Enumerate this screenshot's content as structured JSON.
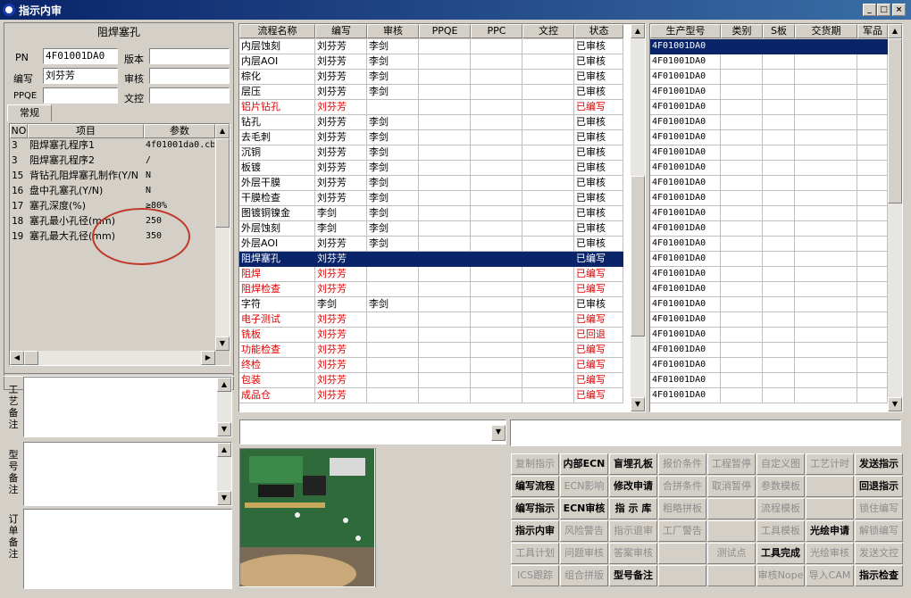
{
  "window": {
    "title": "指示内审",
    "controls": [
      "_",
      "□",
      "×"
    ]
  },
  "left": {
    "title": "阻焊塞孔",
    "labels": {
      "pn": "PN",
      "editor": "编写",
      "ppqe": "PPQE",
      "version": "版本",
      "review": "审核",
      "doc_control": "文控"
    },
    "values": {
      "pn": "4F01001DA0",
      "editor": "刘芬芳",
      "ppqe": "",
      "version": "",
      "review": "",
      "doc_control": ""
    },
    "tab": "常规",
    "param_headers": [
      "NO",
      "项目",
      "参数"
    ],
    "params": [
      {
        "no": "3",
        "item": "阻焊塞孔程序1",
        "value": "4f01001da0.cb"
      },
      {
        "no": "3",
        "item": "阻焊塞孔程序2",
        "value": "/"
      },
      {
        "no": "15",
        "item": "背钻孔阻焊塞孔制作(Y/N",
        "value": "N"
      },
      {
        "no": "16",
        "item": "盘中孔塞孔(Y/N)",
        "value": "N"
      },
      {
        "no": "17",
        "item": "塞孔深度(%)",
        "value": "≥80%"
      },
      {
        "no": "18",
        "item": "塞孔最小孔径(mm)",
        "value": "250"
      },
      {
        "no": "19",
        "item": "塞孔最大孔径(mm)",
        "value": "350"
      }
    ],
    "notes": [
      {
        "label": "工艺备注",
        "value": ""
      },
      {
        "label": "型号备注",
        "value": ""
      },
      {
        "label": "订单备注",
        "value": ""
      }
    ]
  },
  "process_table": {
    "headers": [
      "流程名称",
      "编写",
      "审核",
      "PPQE",
      "PPC",
      "文控",
      "状态"
    ],
    "rows": [
      {
        "name": "内层蚀刻",
        "editor": "刘芬芳",
        "review": "李剑",
        "status": "已审核",
        "red": false
      },
      {
        "name": "内层AOI",
        "editor": "刘芬芳",
        "review": "李剑",
        "status": "已审核",
        "red": false
      },
      {
        "name": "棕化",
        "editor": "刘芬芳",
        "review": "李剑",
        "status": "已审核",
        "red": false
      },
      {
        "name": "层压",
        "editor": "刘芬芳",
        "review": "李剑",
        "status": "已审核",
        "red": false
      },
      {
        "name": "铝片钻孔",
        "editor": "刘芬芳",
        "review": "",
        "status": "已编写",
        "red": true
      },
      {
        "name": "钻孔",
        "editor": "刘芬芳",
        "review": "李剑",
        "status": "已审核",
        "red": false
      },
      {
        "name": "去毛刺",
        "editor": "刘芬芳",
        "review": "李剑",
        "status": "已审核",
        "red": false
      },
      {
        "name": "沉铜",
        "editor": "刘芬芳",
        "review": "李剑",
        "status": "已审核",
        "red": false
      },
      {
        "name": "板镀",
        "editor": "刘芬芳",
        "review": "李剑",
        "status": "已审核",
        "red": false
      },
      {
        "name": "外层干膜",
        "editor": "刘芬芳",
        "review": "李剑",
        "status": "已审核",
        "red": false
      },
      {
        "name": "干膜检查",
        "editor": "刘芬芳",
        "review": "李剑",
        "status": "已审核",
        "red": false
      },
      {
        "name": "图镀铜镍金",
        "editor": "李剑",
        "review": "李剑",
        "status": "已审核",
        "red": false
      },
      {
        "name": "外层蚀刻",
        "editor": "李剑",
        "review": "李剑",
        "status": "已审核",
        "red": false
      },
      {
        "name": "外层AOI",
        "editor": "刘芬芳",
        "review": "李剑",
        "status": "已审核",
        "red": false
      },
      {
        "name": "阻焊塞孔",
        "editor": "刘芬芳",
        "review": "",
        "status": "已编写",
        "red": true,
        "selected": true
      },
      {
        "name": "阻焊",
        "editor": "刘芬芳",
        "review": "",
        "status": "已编写",
        "red": true
      },
      {
        "name": "阻焊检查",
        "editor": "刘芬芳",
        "review": "",
        "status": "已编写",
        "red": true
      },
      {
        "name": "字符",
        "editor": "李剑",
        "review": "李剑",
        "status": "已审核",
        "red": false
      },
      {
        "name": "电子测试",
        "editor": "刘芬芳",
        "review": "",
        "status": "已编写",
        "red": true
      },
      {
        "name": "铣板",
        "editor": "刘芬芳",
        "review": "",
        "status": "已回退",
        "red": true
      },
      {
        "name": "功能检查",
        "editor": "刘芬芳",
        "review": "",
        "status": "已编写",
        "red": true
      },
      {
        "name": "终检",
        "editor": "刘芬芳",
        "review": "",
        "status": "已编写",
        "red": true
      },
      {
        "name": "包装",
        "editor": "刘芬芳",
        "review": "",
        "status": "已编写",
        "red": true
      },
      {
        "name": "成品仓",
        "editor": "刘芬芳",
        "review": "",
        "status": "已编写",
        "red": true
      }
    ]
  },
  "model_table": {
    "headers": [
      "生产型号",
      "类别",
      "S板",
      "交货期",
      "军品"
    ],
    "rows": [
      "4F01001DA0",
      "4F01001DA0",
      "4F01001DA0",
      "4F01001DA0",
      "4F01001DA0",
      "4F01001DA0",
      "4F01001DA0",
      "4F01001DA0",
      "4F01001DA0",
      "4F01001DA0",
      "4F01001DA0",
      "4F01001DA0",
      "4F01001DA0",
      "4F01001DA0",
      "4F01001DA0",
      "4F01001DA0",
      "4F01001DA0",
      "4F01001DA0",
      "4F01001DA0",
      "4F01001DA0",
      "4F01001DA0",
      "4F01001DA0",
      "4F01001DA0",
      "4F01001DA0"
    ]
  },
  "combo_value": "",
  "text_value": "",
  "buttons": [
    [
      {
        "label": "复制指示",
        "enabled": false
      },
      {
        "label": "内部ECN",
        "enabled": true
      },
      {
        "label": "盲埋孔板",
        "enabled": true
      },
      {
        "label": "报价条件",
        "enabled": false
      },
      {
        "label": "工程暂停",
        "enabled": false
      },
      {
        "label": "自定义图",
        "enabled": false
      },
      {
        "label": "工艺计时",
        "enabled": false
      },
      {
        "label": "发送指示",
        "enabled": true
      }
    ],
    [
      {
        "label": "编写流程",
        "enabled": true
      },
      {
        "label": "ECN影响",
        "enabled": false
      },
      {
        "label": "修改申请",
        "enabled": true
      },
      {
        "label": "合拼条件",
        "enabled": false
      },
      {
        "label": "取消暂停",
        "enabled": false
      },
      {
        "label": "参数模板",
        "enabled": false
      },
      {
        "label": "",
        "enabled": false
      },
      {
        "label": "回退指示",
        "enabled": true
      }
    ],
    [
      {
        "label": "编写指示",
        "enabled": true
      },
      {
        "label": "ECN审核",
        "enabled": true
      },
      {
        "label": "指 示 库",
        "enabled": true
      },
      {
        "label": "粗略拼板",
        "enabled": false
      },
      {
        "label": "",
        "enabled": false
      },
      {
        "label": "流程模板",
        "enabled": false
      },
      {
        "label": "",
        "enabled": false
      },
      {
        "label": "锁住编写",
        "enabled": false
      }
    ],
    [
      {
        "label": "指示内审",
        "enabled": true
      },
      {
        "label": "风险警告",
        "enabled": false
      },
      {
        "label": "指示退审",
        "enabled": false
      },
      {
        "label": "工厂警告",
        "enabled": false
      },
      {
        "label": "",
        "enabled": false
      },
      {
        "label": "工具模板",
        "enabled": false
      },
      {
        "label": "光绘申请",
        "enabled": true
      },
      {
        "label": "解锁编写",
        "enabled": false
      }
    ],
    [
      {
        "label": "工具计划",
        "enabled": false
      },
      {
        "label": "问题审核",
        "enabled": false
      },
      {
        "label": "答案审核",
        "enabled": false
      },
      {
        "label": "",
        "enabled": false
      },
      {
        "label": "测试点",
        "enabled": false
      },
      {
        "label": "工具完成",
        "enabled": true
      },
      {
        "label": "光绘审核",
        "enabled": false
      },
      {
        "label": "发送文控",
        "enabled": false
      }
    ],
    [
      {
        "label": "ICS跟踪",
        "enabled": false
      },
      {
        "label": "组合拼版",
        "enabled": false
      },
      {
        "label": "型号备注",
        "enabled": true
      },
      {
        "label": "",
        "enabled": false
      },
      {
        "label": "",
        "enabled": false
      },
      {
        "label": "审核Nope",
        "enabled": false
      },
      {
        "label": "导入CAM",
        "enabled": false
      },
      {
        "label": "指示检查",
        "enabled": true
      }
    ]
  ],
  "colors": {
    "selection": "#0a246a",
    "red_text": "#e00000",
    "annotation": "#c0392b"
  }
}
